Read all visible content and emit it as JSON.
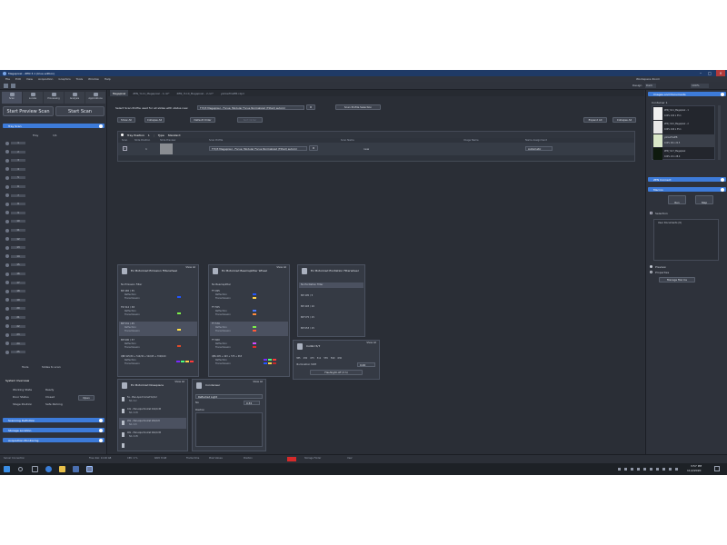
{
  "app": {
    "title": "Megapixel - ZEN 3.1 (blue edition)",
    "menu": [
      "File",
      "Edit",
      "View",
      "Acquisition",
      "Graphics",
      "Tools",
      "Window",
      "Help"
    ],
    "workspace_label": "Workspace Zoom",
    "design_label": "Design",
    "design_value": "Dark",
    "workspace_value": "100%"
  },
  "left": {
    "tabs": [
      "Scan",
      "Locate",
      "Processing",
      "Analysis",
      "Applications"
    ],
    "start_preview": "Start Preview Scan",
    "start_scan": "Start Scan",
    "section_tray": "Tray Scan",
    "tray_label": "Tray",
    "tray_value": "1/1",
    "slots": [
      "1",
      "2",
      "3",
      "4",
      "5",
      "6",
      "7",
      "8",
      "9",
      "10",
      "11",
      "12",
      "13",
      "14",
      "15",
      "16",
      "17",
      "18",
      "19",
      "20",
      "21",
      "22",
      "23",
      "24",
      "25"
    ],
    "tools_label": "Tools",
    "tools_sub": "Slides to scan",
    "system_overview": "System Overview",
    "working_state_label": "Working State",
    "working_state_value": "Ready",
    "door_status_label": "Door Status",
    "door_status_value": "Closed",
    "door_button": "Open",
    "stage_position_label": "Stage Position",
    "stage_position_value": "Safe Parking",
    "section_scanning": "Scanning Definition",
    "section_storage": "Storage Location",
    "section_acquisition": "Acquisition Monitoring"
  },
  "tabs": [
    "Megapixel",
    "ZEN_YL11_Megapixel - 1.czi*",
    "ZEN_YL10_Megapixel - 2.czi*",
    "yellowTrialEB.czpd"
  ],
  "main": {
    "instruction": "Select Scan Profile used for all slides with status new",
    "profile_select": "TYQ3 Megapixel - Focus; Modular Focus Normalized (Tilted) automl",
    "gear": "⚙",
    "profile_btn": "Scan Profile Selection",
    "btn_show_all": "Show All",
    "btn_collapse_all": "Collapse All",
    "btn_default_order": "Default Order",
    "btn_sort_order": "Sort Order",
    "btn_expand_all": "Expand All",
    "btn_collapse_all2": "Collapse All",
    "tray_position_label": "Tray Position",
    "tray_position_value": "1",
    "type_label": "Type",
    "type_value": "Standard",
    "columns": [
      "Scan",
      "Slide Position",
      "Slide Preview",
      "Scan Profile",
      "Scan Name",
      "Image Name",
      "Name Assignment"
    ],
    "row": {
      "slide_position": "1",
      "scan_profile": "TYQ3 Megapixel - Focus; Modular Focus Normalized (Tilted) automl",
      "scan_name": "new",
      "name_assignment": "Automatic"
    }
  },
  "panels": {
    "emission": {
      "title": "Ex Motorized Emission Filterwheel",
      "show_all": "Show All",
      "none_label": "No Emission Filter",
      "items": [
        {
          "title": "BP 465 / 35",
          "sub1": "Reflection",
          "sub2": "Transmission"
        },
        {
          "title": "TR 512 / 38",
          "sub1": "Reflection",
          "sub2": "Transmission"
        },
        {
          "title": "BP 531 / 45",
          "sub1": "Reflection",
          "sub2": "Transmission"
        },
        {
          "title": "BP 600 / 37",
          "sub1": "Reflection",
          "sub2": "Transmission"
        },
        {
          "title": "QBP 425/30 + 514/30 + 592/25 + 709/100",
          "sub1": "Reflection",
          "sub2": "Transmission"
        }
      ]
    },
    "beamsplitter": {
      "title": "Ex Motorized Beamsplitter Wheel",
      "show_all": "Show All",
      "none_label": "No Beamsplitter",
      "items": [
        {
          "title": "FT 495",
          "sub1": "Reflection",
          "sub2": "Transmission"
        },
        {
          "title": "FT 555",
          "sub1": "Reflection",
          "sub2": "Transmission"
        },
        {
          "title": "FT 570",
          "sub1": "Reflection",
          "sub2": "Transmission"
        },
        {
          "title": "FT 660",
          "sub1": "Reflection",
          "sub2": "Transmission"
        },
        {
          "title": "QBS 405 + 493 + 575 + 653",
          "sub1": "Reflection",
          "sub2": "Transmission"
        }
      ]
    },
    "excitation": {
      "title": "Ex Motorized Excitation Filterwheel",
      "none_label": "No Excitation Filter",
      "items": [
        "BP 405 / 5",
        "BP 493 / 10",
        "BP 575 / 15",
        "BP 653 / 15"
      ]
    },
    "colibri": {
      "title": "Colibri 5/7",
      "show_all": "Show All",
      "channels": [
        "385",
        "430",
        "475",
        "511",
        "555",
        "590",
        "630"
      ],
      "intensity_label": "Illumination Shift",
      "intensity_value": "0.00",
      "button": "Flashlight off (3 h)"
    },
    "nosepiece": {
      "title": "Ex Motorized Nosepiece",
      "show_all": "Show All",
      "items": [
        {
          "title": "5x - Plan-Apochromat 5x/0.2",
          "sub": "NA: 0.2"
        },
        {
          "title": "10x - Plan-Apochromat 10x/0.45",
          "sub": "NA: 0.45"
        },
        {
          "title": "20x - Plan-Apochromat 20x/0.8",
          "sub": "NA: 0.8"
        },
        {
          "title": "40x - Plan-Apochromat 40x/0.95",
          "sub": "NA: 0.95"
        },
        {
          "title": "",
          "sub": ""
        }
      ]
    },
    "condenser": {
      "title": "Condenser",
      "show_all": "Show All",
      "select": "Reflected Light",
      "na_label": "NA",
      "na_value": "0.55",
      "position_label": "Position",
      "position_value": "Switch On"
    }
  },
  "right_panel": {
    "images_header": "Images and Documents",
    "container_label": "Container 1",
    "thumbs": [
      {
        "name": "ZEN_YL11_Megapixel - 1",
        "info": "100% 100 x 35.1"
      },
      {
        "name": "ZEN_YL10_Megapixel - 2",
        "info": "100% 100 x 35.1"
      },
      {
        "name": "yellowTrialEB",
        "info": "100% 99 x 22.5"
      },
      {
        "name": "ZEN_YL17_Megapixel",
        "info": "100% 24 x 28.0"
      }
    ],
    "zen_connect": "ZEN Connect",
    "macros": "Macros",
    "run_label": "Run",
    "step_label": "Step",
    "selection_label": "Selection",
    "user_documents": "User Documents (0)",
    "preview_label": "Preview",
    "properties_label": "Properties",
    "manage_button": "Manage Macros"
  },
  "statusbar": {
    "system": "Server Connection",
    "free_disk": "Free disk: 14.06 GB",
    "cpu": "CPU: 2 %",
    "ram": "RAM: 8 GB",
    "frame_time": "Frame time",
    "pixel_values": "Pixel Values",
    "position": "Position",
    "storage": "Storage Folder",
    "user": "User"
  },
  "taskbar": {
    "time": "3:57 PM",
    "date": "11/2/2020"
  },
  "colors": {
    "accent": "#3d7bd9",
    "panel": "#353a44",
    "background": "#2a2e36"
  }
}
